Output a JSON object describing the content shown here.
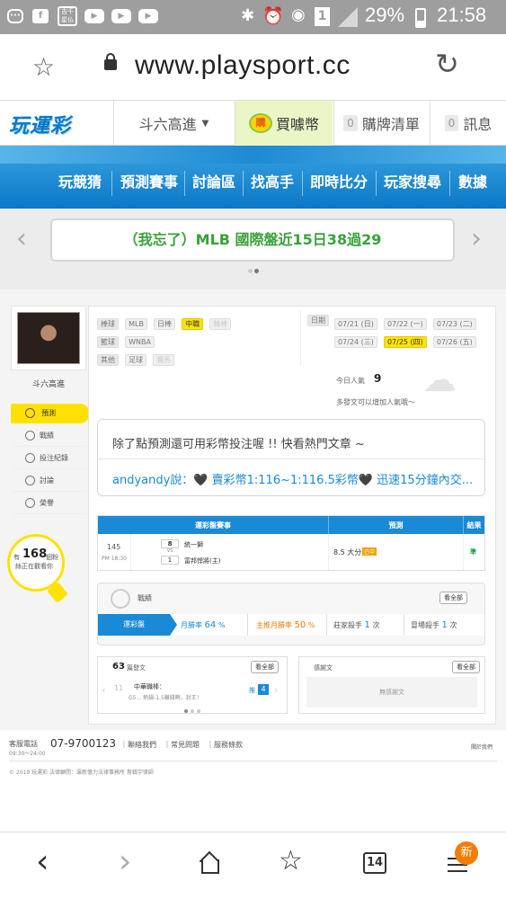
{
  "status_bar": {
    "notification_icons": [
      "comment-icon",
      "facebook-icon",
      "app-icon",
      "youtube-icon",
      "youtube-icon",
      "youtube-icon"
    ],
    "app_icon_text": "吉千 星仏",
    "battery": "29%",
    "time": "21:58",
    "sim_label": "1"
  },
  "browser": {
    "url": "www.playsport.cc"
  },
  "site_header": {
    "logo_text": "玩運彩",
    "user_name": "斗六高進",
    "buy_coins_badge": "購",
    "buy_coins_label": "買噱幣",
    "cart_count": "0",
    "cart_label": "購牌清單",
    "msg_count": "0",
    "msg_label": "訊息"
  },
  "nav": {
    "items": [
      "玩競猜",
      "預測賽事",
      "討論區",
      "找高手",
      "即時比分",
      "玩家搜尋",
      "數據"
    ]
  },
  "banner": {
    "text": "（我忘了）MLB 國際盤近15日38過29",
    "active_color": "#3aa13a"
  },
  "profile": {
    "name": "斗六高進",
    "menu": [
      {
        "label": "預測",
        "icon": "target-icon",
        "active": true
      },
      {
        "label": "戰績",
        "icon": "chart-icon",
        "active": false
      },
      {
        "label": "投注紀錄",
        "icon": "record-icon",
        "active": false
      },
      {
        "label": "討論",
        "icon": "discuss-icon",
        "active": false
      },
      {
        "label": "榮譽",
        "icon": "honor-icon",
        "active": false
      }
    ],
    "online_prefix": "有",
    "online_count": "168",
    "online_suffix": "個粉",
    "online_line2": "絲正在觀看你"
  },
  "filters": {
    "rows": [
      {
        "label": "棒球",
        "tags": [
          {
            "t": "MLB",
            "s": ""
          },
          {
            "t": "日棒",
            "s": ""
          },
          {
            "t": "中職",
            "s": "on"
          },
          {
            "t": "韓棒",
            "s": "dim"
          }
        ]
      },
      {
        "label": "籃球",
        "tags": [
          {
            "t": "WNBA",
            "s": ""
          }
        ]
      },
      {
        "label": "其他",
        "tags": [
          {
            "t": "足球",
            "s": ""
          },
          {
            "t": "賽馬",
            "s": "dim"
          }
        ]
      }
    ],
    "date_label": "日期",
    "dates_row1": [
      "07/21 (日)",
      "07/22 (一)",
      "07/23 (二)"
    ],
    "dates_row2": [
      "07/24 (三)",
      "07/25 (四)",
      "07/26 (五)"
    ],
    "active_date": "07/25 (四)"
  },
  "popularity": {
    "label": "今日人氣",
    "value": "9",
    "note": "多發文可以增加人氣哦～"
  },
  "promo": {
    "line1": "除了點預測還可用彩幣投注喔 !! 快看熱門文章 ~",
    "line2": "andyandy說：🖤 賣彩幣1:116~1:116.5彩幣🖤 迅速15分鐘內交..."
  },
  "prediction_table": {
    "headers": [
      "運彩盤賽事",
      "預測",
      "結果"
    ],
    "row": {
      "game_no": "145",
      "time": "PM 18:30",
      "score_top": "8",
      "vs": "VS",
      "score_bottom": "1",
      "team_top": "統一獅",
      "team_bottom": "富邦悍將(主)",
      "prediction": "8.5 大分",
      "pred_badge": "已中",
      "result": "準"
    }
  },
  "record": {
    "title": "戰績",
    "view_all": "看全部",
    "tabs": [
      {
        "label": "運彩盤",
        "value": "",
        "unit": "",
        "active": true
      },
      {
        "label": "月勝率",
        "value": "64",
        "unit": "%",
        "active": false
      },
      {
        "label": "主推月勝率",
        "value": "50",
        "unit": "%",
        "active": false
      },
      {
        "label": "莊家殺手",
        "value": "1",
        "unit": "次",
        "active": false
      },
      {
        "label": "冒場殺手",
        "value": "1",
        "unit": "次",
        "active": false
      }
    ]
  },
  "posts": {
    "count": "63",
    "label": "篇發文",
    "view_all": "看全部",
    "item_no": "11",
    "item_title": "中華職棒：",
    "item_sub": "G5... 熱鍋-1.5賺錢啊，封王！",
    "reply_prefix": "推",
    "reply_count": "4"
  },
  "thanks": {
    "label": "感謝文",
    "view_all": "看全部",
    "empty": "無感謝文"
  },
  "footer": {
    "service_label": "客服電話",
    "service_hours": "09:30～24:00",
    "phone": "07-9700123",
    "links": [
      "聯絡我們",
      "常見問題",
      "服務條款"
    ],
    "about": "關於我們",
    "copyright": "© 2019 玩運彩  法律顧問：瀛新億力法律事務所 詹鎮宇律師"
  },
  "bottom_nav": {
    "tab_count": "14",
    "new_badge": "新"
  }
}
